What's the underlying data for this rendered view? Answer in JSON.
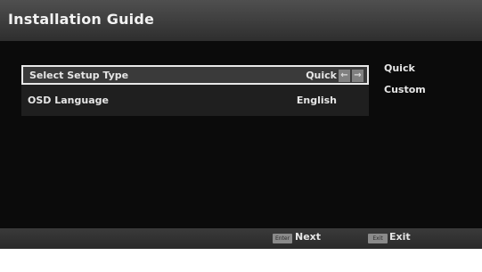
{
  "header": {
    "title": "Installation Guide"
  },
  "menu": {
    "rows": [
      {
        "label": "Select Setup Type",
        "value": "Quick"
      },
      {
        "label": "OSD Language",
        "value": "English"
      }
    ]
  },
  "options": [
    "Quick",
    "Custom"
  ],
  "footer": {
    "next": {
      "key": "Enter",
      "label": "Next"
    },
    "exit": {
      "key": "Exit",
      "label": "Exit"
    }
  },
  "icons": {
    "left_arrow": "arrow-left-icon",
    "right_arrow": "arrow-right-icon"
  },
  "colors": {
    "header": "#4a4a4a",
    "screen": "#0b0b0b",
    "selected_border": "#e8e8e8"
  }
}
